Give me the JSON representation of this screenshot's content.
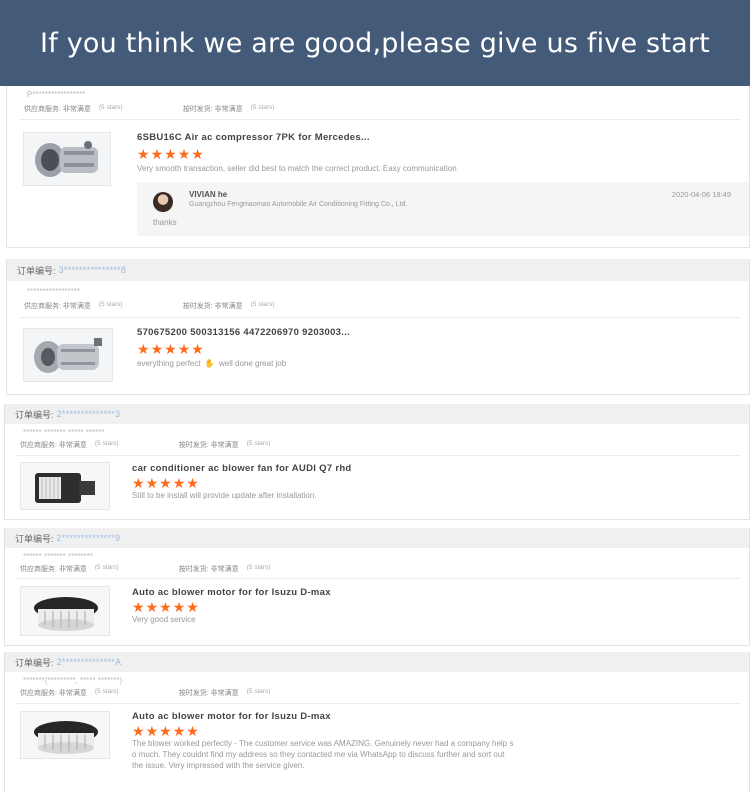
{
  "banner": {
    "text": "If you think we are good,please give us five start"
  },
  "rating_labels": {
    "supplier_service": "供应商服务: 非常满意",
    "on_time_shipping": "按时发货: 非常满意",
    "stars_note": "(5 stars)"
  },
  "order_label": "订单编号:",
  "star_glyph": "★",
  "reviews": [
    {
      "order_no": "",
      "buyer": "P*****************",
      "title": "6SBU16C Air ac compressor 7PK for Mercedes...",
      "stars": 5,
      "text": "Very smooth transaction, seller did best to match the correct product. Easy communication",
      "reply": {
        "name": "VIVIAN he",
        "company": "Guangzhou Fengmaomao Automobile Air Conditioning Fitting Co., Ltd.",
        "date": "2020-04-06 18:49",
        "text": "thanks"
      }
    },
    {
      "order_no": "3***************8",
      "buyer": "*****************",
      "title": "570675200 500313156 4472206970 9203003...",
      "stars": 5,
      "text_before": "everything perfect",
      "text_after": "well done great job"
    },
    {
      "order_no": "2**************3",
      "buyer": "****** ******* ***** ******",
      "title": "car conditioner ac blower fan for AUDI Q7 rhd",
      "stars": 5,
      "text": "Still to be install will provide update after installation."
    },
    {
      "order_no": "2**************9",
      "buyer": "****** ******* ********",
      "title": "Auto ac blower motor for for Isuzu D-max",
      "stars": 5,
      "text": "Very good service"
    },
    {
      "order_no": "2**************A",
      "buyer": "*******(*********, ***** *******)",
      "title": "Auto ac blower motor for for Isuzu D-max",
      "stars": 5,
      "text_line1": "The blower worked perfectly - The customer service was AMAZING. Genuinely never had a company help s",
      "text_line2": "o much. They couldnt find my address so they contacted me via WhatsApp to discuss further and sort out",
      "text_line3": "the issue. Very impressed with the service given."
    }
  ]
}
